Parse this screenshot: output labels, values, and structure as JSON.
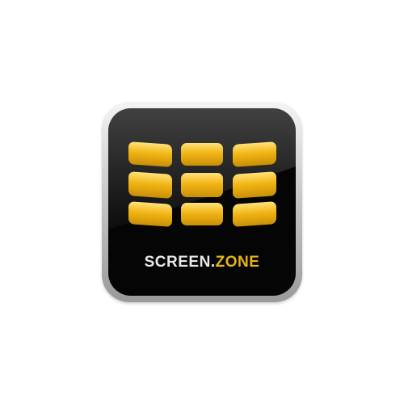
{
  "logo": {
    "brand_main": "SCREEN",
    "brand_dot": ".",
    "brand_accent": "ZONE",
    "tile_grid": {
      "rows": 3,
      "columns": 3
    },
    "colors": {
      "background": "#ffffff",
      "face": "#050505",
      "tile_light": "#ffe27a",
      "tile_mid": "#f2b515",
      "tile_dark": "#c98f07",
      "text_main": "#e9e9e9",
      "text_accent": "#e8b418"
    }
  }
}
